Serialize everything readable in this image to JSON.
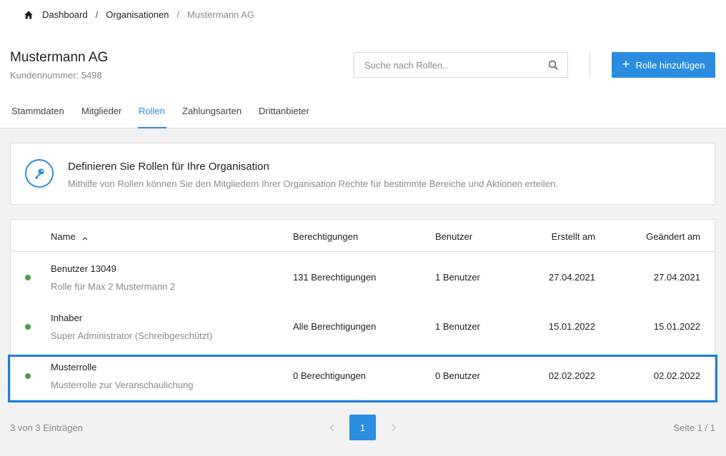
{
  "breadcrumb": {
    "items": [
      "Dashboard",
      "Organisationen"
    ],
    "current": "Mustermann AG",
    "separator": "/"
  },
  "header": {
    "title": "Mustermann AG",
    "subtitle": "Kundennummer: 5498"
  },
  "search": {
    "placeholder": "Suche nach Rollen..",
    "value": ""
  },
  "actions": {
    "add_label": "Rolle hinzufügen",
    "add_icon": "plus"
  },
  "tabs": [
    {
      "label": "Stammdaten",
      "active": false
    },
    {
      "label": "Mitglieder",
      "active": false
    },
    {
      "label": "Rollen",
      "active": true
    },
    {
      "label": "Zahlungsarten",
      "active": false
    },
    {
      "label": "Drittanbieter",
      "active": false
    }
  ],
  "info": {
    "icon": "key-icon",
    "title": "Definieren Sie Rollen für Ihre Organisation",
    "text": "Mithilfe von Rollen können Sie den Mitgliedern Ihrer Organisation Rechte für bestimmte Bereiche und Aktionen erteilen."
  },
  "table": {
    "columns": [
      "Name",
      "Berechtigungen",
      "Benutzer",
      "Erstellt am",
      "Geändert am"
    ],
    "sort": {
      "column": "Name",
      "direction": "asc"
    },
    "rows": [
      {
        "status": "active",
        "name": "Benutzer 13049",
        "description": "Rolle für Max 2 Mustermann 2",
        "permissions": "131 Berechtigungen",
        "users": "1 Benutzer",
        "created": "27.04.2021",
        "modified": "27.04.2021"
      },
      {
        "status": "active",
        "name": "Inhaber",
        "description": "Super Administrator (Schreibgeschützt)",
        "permissions": "Alle Berechtigungen",
        "users": "1 Benutzer",
        "created": "15.01.2022",
        "modified": "15.01.2022"
      },
      {
        "status": "active",
        "name": "Musterrolle",
        "description": "Musterrolle zur Veranschaulichung",
        "permissions": "0 Berechtigungen",
        "users": "0 Benutzer",
        "created": "02.02.2022",
        "modified": "02.02.2022"
      }
    ]
  },
  "footer": {
    "count": "3 von 3 Einträgen",
    "current_page": "1",
    "page_info": "Seite 1 / 1"
  },
  "colors": {
    "accent": "#2b8de0",
    "status_active": "#43a047",
    "highlight": "#1a7fe0"
  }
}
